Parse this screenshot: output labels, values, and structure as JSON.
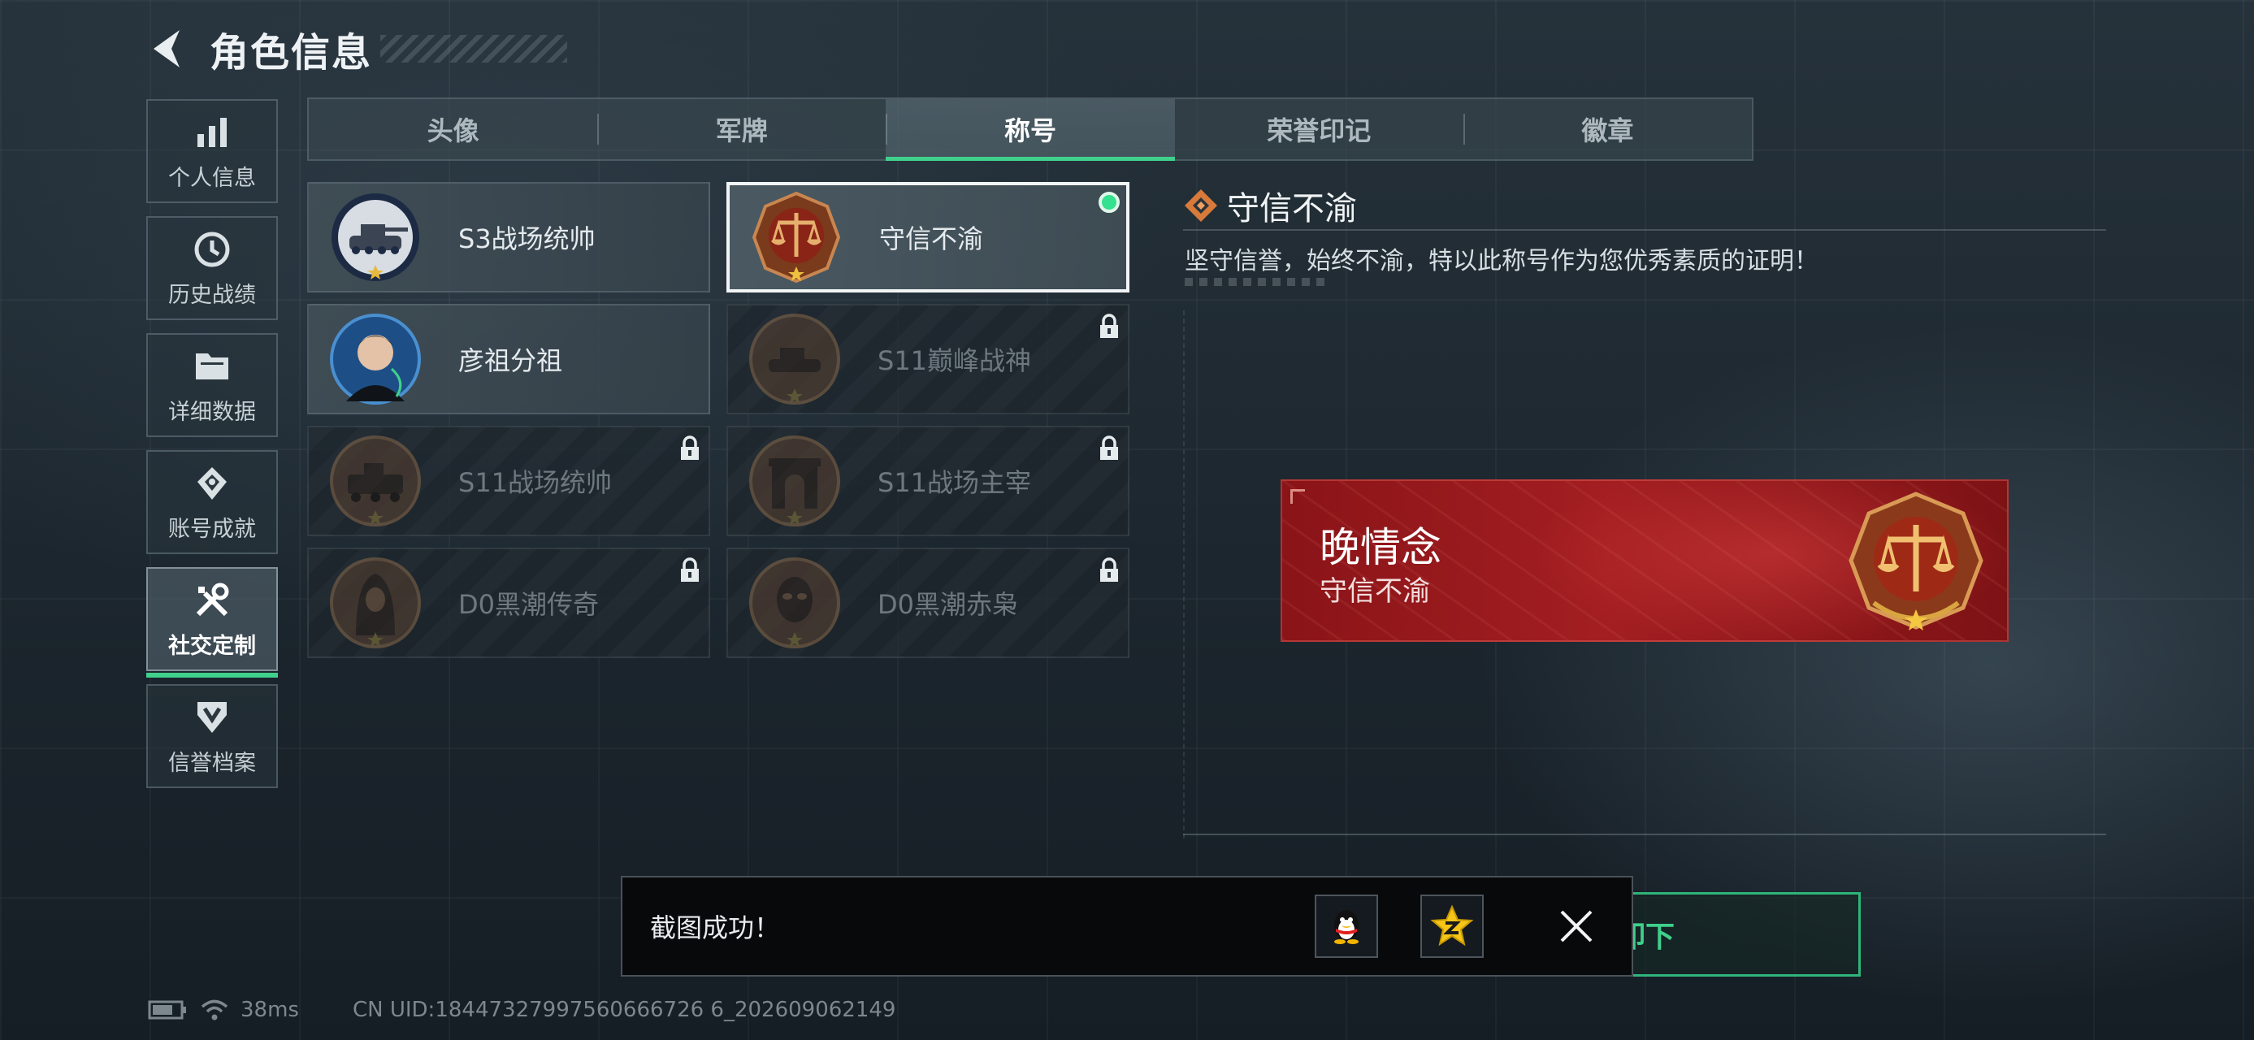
{
  "header": {
    "title": "角色信息"
  },
  "sidebar": {
    "items": [
      {
        "label": "个人信息",
        "icon": "bar-chart-icon"
      },
      {
        "label": "历史战绩",
        "icon": "clock-icon"
      },
      {
        "label": "详细数据",
        "icon": "folder-icon"
      },
      {
        "label": "账号成就",
        "icon": "achievement-icon"
      },
      {
        "label": "社交定制",
        "icon": "tools-icon",
        "active": true
      },
      {
        "label": "信誉档案",
        "icon": "credit-shield-icon"
      }
    ]
  },
  "tabs": [
    {
      "label": "头像"
    },
    {
      "label": "军牌"
    },
    {
      "label": "称号",
      "active": true
    },
    {
      "label": "荣誉印记"
    },
    {
      "label": "徽章"
    }
  ],
  "titles": [
    {
      "label": "S3战场统帅",
      "icon": "tank-emblem-icon",
      "locked": false
    },
    {
      "label": "守信不渝",
      "icon": "scales-emblem-icon",
      "locked": false,
      "selected": true,
      "equipped": true
    },
    {
      "label": "彦祖分祖",
      "icon": "portrait-emblem-icon",
      "locked": false
    },
    {
      "label": "S11巅峰战神",
      "icon": "tank-emblem-icon",
      "locked": true
    },
    {
      "label": "S11战场统帅",
      "icon": "armored-vehicle-emblem-icon",
      "locked": true
    },
    {
      "label": "S11战场主宰",
      "icon": "arch-emblem-icon",
      "locked": true
    },
    {
      "label": "D0黑潮传奇",
      "icon": "hooded-figure-emblem-icon",
      "locked": true
    },
    {
      "label": "D0黑潮赤枭",
      "icon": "masked-figure-emblem-icon",
      "locked": true
    }
  ],
  "detail": {
    "title": "守信不渝",
    "description": "坚守信誉，始终不渝，特以此称号作为您优秀素质的证明！"
  },
  "preview": {
    "player_name": "晚情念",
    "title": "守信不渝"
  },
  "action": {
    "label": "卸下"
  },
  "toast": {
    "message": "截图成功！"
  },
  "status": {
    "ping": "38ms",
    "uid": "CN UID:18447327997560666726 6_202609062149"
  },
  "colors": {
    "accent_green": "#3fd08c",
    "plate_red": "#a31e21",
    "emblem_bronze": "#b5673a"
  }
}
